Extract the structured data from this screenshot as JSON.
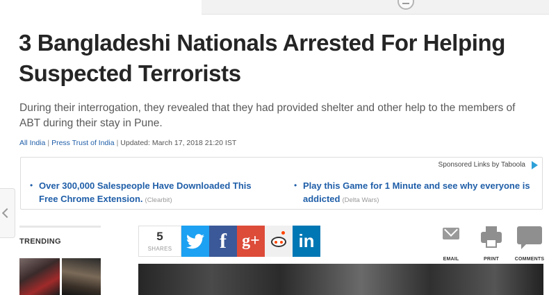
{
  "article": {
    "headline": "3 Bangladeshi Nationals Arrested For Helping Suspected Terrorists",
    "summary": "During their interrogation, they revealed that they had provided shelter and other help to the members of ABT during their stay in Pune.",
    "byline": {
      "section": "All India",
      "source": "Press Trust of India",
      "updated": "Updated: March 17, 2018 21:20 IST",
      "separator": "|"
    }
  },
  "sponsored": {
    "label": "Sponsored Links by Taboola",
    "items": [
      {
        "bullet": "•",
        "title": "Over 300,000 Salespeople Have Downloaded This Free Chrome Extension.",
        "source": "(Clearbit)"
      },
      {
        "bullet": "•",
        "title": "Play this Game for 1 Minute and see why everyone is addicted",
        "source": "(Delta Wars)"
      }
    ]
  },
  "trending": {
    "title": "TRENDING"
  },
  "share": {
    "count": "5",
    "count_label": "SHARES",
    "buttons": {
      "facebook": "f",
      "gplus": "g+",
      "linkedin": "in"
    }
  },
  "tools": {
    "email": "EMAIL",
    "print": "PRINT",
    "comments": "COMMENTS"
  },
  "colors": {
    "link": "#1f5ea8",
    "twitter": "#1da1f2",
    "facebook": "#3b5998",
    "gplus": "#dd4b39",
    "linkedin": "#0077b5",
    "reddit_accent": "#ff4500"
  }
}
